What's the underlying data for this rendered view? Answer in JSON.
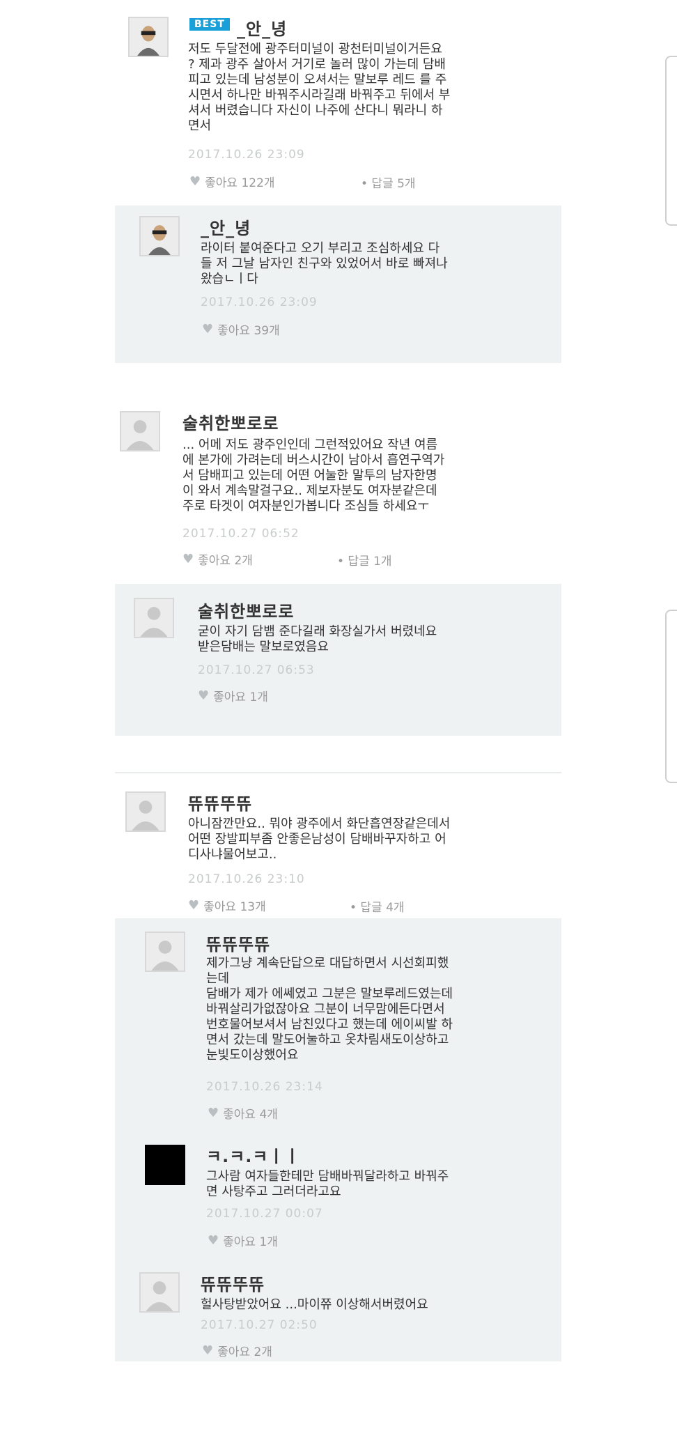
{
  "comments": [
    {
      "best_label": "BEST",
      "name": "_안_녕",
      "body": "저도 두달전에 광주터미널이 광천터미널이거든요\n? 제과 광주 살아서 거기로 놀러 많이 가는데 담배\n피고 있는데 남성분이 오셔서는 말보루 레드 를 주\n시면서 하나만 바꿔주시라길래 바꿔주고 뒤에서 부\n셔서 버렸습니다 자신이 나주에 산다니 뭐라니 하\n면서",
      "time": "2017.10.26 23:09",
      "likes": "좋아요 122개",
      "replies_count": "• 답글 5개",
      "replies": [
        {
          "name": "_안_녕",
          "body": "라이터 붙여준다고 오기 부리고 조심하세요 다\n들 저 그날 남자인 친구와 있었어서 바로 빠져나\n왔습ㄴㅣ다",
          "time": "2017.10.26 23:09",
          "likes": "좋아요 39개"
        }
      ]
    },
    {
      "name": "술취한뽀로로",
      "body": "... 어메 저도 광주인인데 그런적있어요 작년 여름\n에 본가에 가려는데 버스시간이 남아서 흡연구역가\n서 담배피고 있는데 어떤 어눌한 말투의 남자한명\n이 와서 계속말걸구요.. 제보자분도 여자분같은데\n주로 타겟이 여자분인가봅니다 조심들 하세요ㅜ",
      "time": "2017.10.27 06:52",
      "likes": "좋아요 2개",
      "replies_count": "• 답글 1개",
      "replies": [
        {
          "name": "술취한뽀로로",
          "body": "굳이 자기 담뱀 준다길래 화장실가서 버렸네요\n받은담배는 말보로였음요",
          "time": "2017.10.27 06:53",
          "likes": "좋아요 1개"
        }
      ]
    },
    {
      "name": "뜌뜌뚜뜌",
      "body": "아니잠깐만요.. 뭐야 광주에서 화단흡연장같은데서\n어떤 장발피부좀 안좋은남성이 담배바꾸자하고 어\n디사냐물어보고..",
      "time": "2017.10.26 23:10",
      "likes": "좋아요 13개",
      "replies_count": "• 답글 4개",
      "replies": [
        {
          "name": "뜌뜌뚜뜌",
          "body": "제가그냥 계속단답으로 대답하면서 시선회피했\n는데\n담배가 제가 에쎄였고 그분은 말보루레드였는데\n바꿔살리가없잖아요 그분이 너무맘에든다면서\n번호물어보셔서 남친있다고 했는데 에이씨발 하\n면서 갔는데 말도어눌하고 옷차림새도이상하고\n눈빛도이상했어요",
          "time": "2017.10.26 23:14",
          "likes": "좋아요 4개"
        },
        {
          "name": "ㅋ.ㅋ.ㅋㅣㅣ",
          "body": "그사람 여자들한테만 담배바꿔달라하고 바꿔주\n면 사탕주고 그러더라고요",
          "time": "2017.10.27 00:07",
          "likes": "좋아요 1개"
        },
        {
          "name": "뜌뜌뚜뜌",
          "body": "헐사탕받았어요 ...마이쮸 이상해서버렸어요",
          "time": "2017.10.27 02:50",
          "likes": "좋아요 2개"
        }
      ]
    }
  ],
  "icons": {
    "heart": "heart-icon",
    "avatar": "default-avatar-icon"
  },
  "colors": {
    "reply_bg": "#eef2f2",
    "best_badge": "#1aa0d8",
    "timestamp": "#c8cccc"
  }
}
